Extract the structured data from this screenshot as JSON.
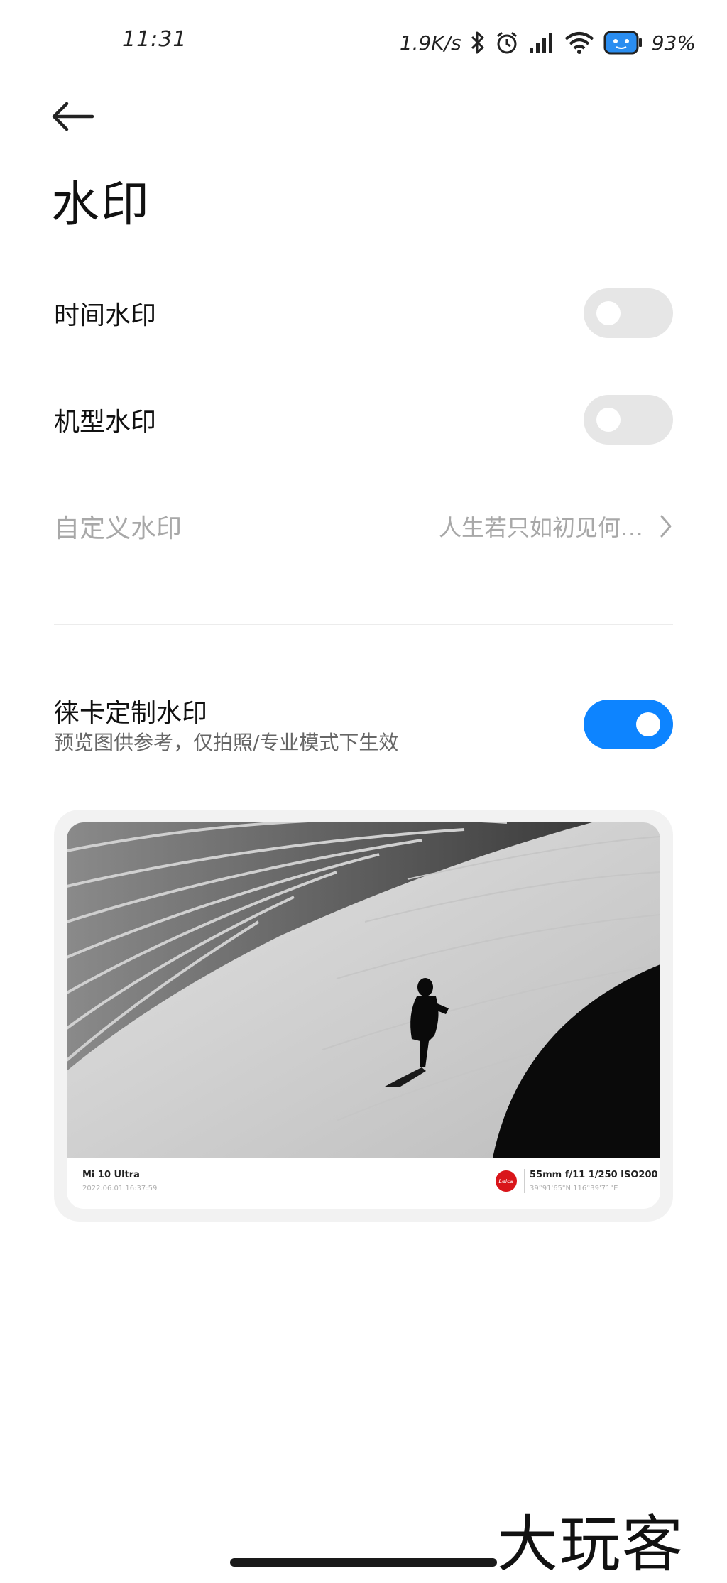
{
  "status_bar": {
    "time": "11:31",
    "net_speed": "1.9K/s",
    "battery_percent": "93%",
    "icons": [
      "bluetooth-icon",
      "alarm-icon",
      "signal-icon",
      "wifi-icon",
      "battery-icon"
    ]
  },
  "header": {
    "title": "水印"
  },
  "settings": {
    "time_watermark": {
      "label": "时间水印",
      "enabled": false
    },
    "model_watermark": {
      "label": "机型水印",
      "enabled": false
    },
    "custom_watermark": {
      "label": "自定义水印",
      "value": "人生若只如初见何…"
    }
  },
  "leica": {
    "label": "徕卡定制水印",
    "description": "预览图供参考，仅拍照/专业模式下生效",
    "enabled": true
  },
  "preview": {
    "model": "Mi 10 Ultra",
    "datetime": "2022.06.01 16:37:59",
    "logo_text": "Leica",
    "params": "55mm  f/11  1/250  ISO200",
    "coords": "39°91'65\"N  116°39'71\"E"
  },
  "brand_watermark": "大玩客",
  "colors": {
    "accent": "#0d84ff",
    "leica_red": "#d9151a",
    "toggle_off": "#e6e6e6"
  }
}
